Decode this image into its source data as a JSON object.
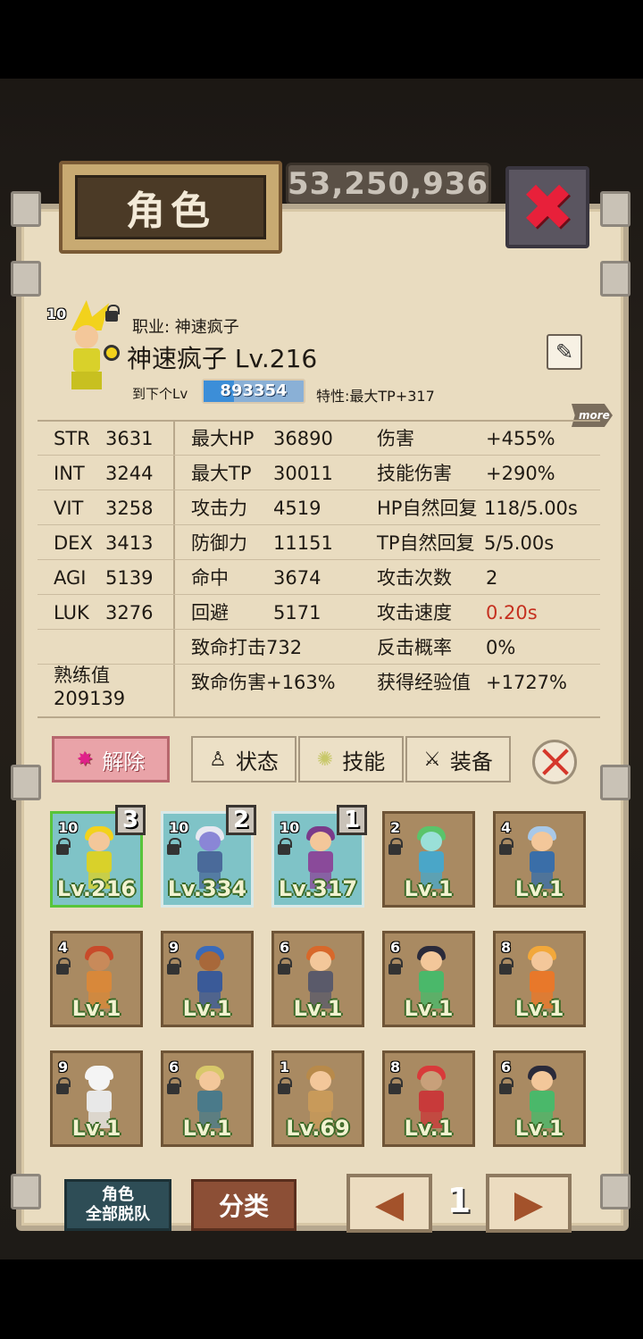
{
  "header": {
    "gold": "53,250,936",
    "title": "角色"
  },
  "character": {
    "job_label": "职业: 神速疯子",
    "name_level": "神速疯子 Lv.216",
    "next_label": "到下个Lv",
    "next_exp": "893354",
    "next_exp_progress": 0.3,
    "trait": "特性:最大TP+317",
    "star": "10",
    "more": "more"
  },
  "stats": {
    "base": [
      {
        "k": "STR",
        "v": "3631"
      },
      {
        "k": "INT",
        "v": "3244"
      },
      {
        "k": "VIT",
        "v": "3258"
      },
      {
        "k": "DEX",
        "v": "3413"
      },
      {
        "k": "AGI",
        "v": "5139"
      },
      {
        "k": "LUK",
        "v": "3276"
      }
    ],
    "proficiency_label": "熟练值",
    "proficiency_value": "209139",
    "mid": [
      {
        "k": "最大HP",
        "v": "36890"
      },
      {
        "k": "最大TP",
        "v": "30011"
      },
      {
        "k": "攻击力",
        "v": "4519"
      },
      {
        "k": "防御力",
        "v": "11151"
      },
      {
        "k": "命中",
        "v": "3674"
      },
      {
        "k": "回避",
        "v": "5171"
      },
      {
        "k": "致命打击",
        "v": "732"
      },
      {
        "k": "致命伤害",
        "v": "+163%"
      }
    ],
    "right": [
      {
        "k": "伤害",
        "v": "+455%"
      },
      {
        "k": "技能伤害",
        "v": "+290%"
      },
      {
        "k": "HP自然回复",
        "v": "118/5.00s"
      },
      {
        "k": "TP自然回复",
        "v": "5/5.00s"
      },
      {
        "k": "攻击次数",
        "v": "2"
      },
      {
        "k": "攻击速度",
        "v": "0.20s"
      },
      {
        "k": "反击概率",
        "v": "0%"
      },
      {
        "k": "获得经验值",
        "v": "+1727%"
      }
    ]
  },
  "tabs": {
    "release": "解除",
    "status": "状态",
    "skill": "技能",
    "equip": "装备"
  },
  "roster": [
    {
      "star": "10",
      "lv": "Lv.216",
      "party": "3",
      "hair": "#f2d21c",
      "skin": "#f3c79a",
      "body": "#d9d12a",
      "sel": true
    },
    {
      "star": "10",
      "lv": "Lv.334",
      "party": "2",
      "hair": "#e8e8f0",
      "skin": "#8a86d6",
      "body": "#4a6a9a"
    },
    {
      "star": "10",
      "lv": "Lv.317",
      "party": "1",
      "hair": "#7a3a8a",
      "skin": "#f3c79a",
      "body": "#8a4a9a"
    },
    {
      "star": "2",
      "lv": "Lv.1",
      "hair": "#5ac46a",
      "skin": "#9ae0d8",
      "body": "#4aa6c8"
    },
    {
      "star": "4",
      "lv": "Lv.1",
      "hair": "#a8c8e8",
      "skin": "#f3c79a",
      "body": "#3a6ea8"
    },
    {
      "star": "4",
      "lv": "Lv.1",
      "hair": "#c84a2a",
      "skin": "#c88a5a",
      "body": "#d8883a"
    },
    {
      "star": "9",
      "lv": "Lv.1",
      "hair": "#3a6ab8",
      "skin": "#a8683a",
      "body": "#3a5a98"
    },
    {
      "star": "6",
      "lv": "Lv.1",
      "hair": "#d8682a",
      "skin": "#f3c79a",
      "body": "#5a5a6a"
    },
    {
      "star": "6",
      "lv": "Lv.1",
      "hair": "#2a2a3a",
      "skin": "#f3c79a",
      "body": "#4ab86a"
    },
    {
      "star": "8",
      "lv": "Lv.1",
      "hair": "#f2a83a",
      "skin": "#f3c79a",
      "body": "#e8782a"
    },
    {
      "star": "9",
      "lv": "Lv.1",
      "hair": "#f4f4f4",
      "skin": "#f4f4f4",
      "body": "#e8e8e8"
    },
    {
      "star": "6",
      "lv": "Lv.1",
      "hair": "#d8c86a",
      "skin": "#f3c79a",
      "body": "#4a7a8a"
    },
    {
      "star": "1",
      "lv": "Lv.69",
      "hair": "#b88a4a",
      "skin": "#f3c79a",
      "body": "#c89a5a"
    },
    {
      "star": "8",
      "lv": "Lv.1",
      "hair": "#d83a3a",
      "skin": "#c8a07a",
      "body": "#c83a3a"
    },
    {
      "star": "6",
      "lv": "Lv.1",
      "hair": "#2a2a3a",
      "skin": "#f3c79a",
      "body": "#4ab86a"
    }
  ],
  "bottom": {
    "dismiss_line1": "角色",
    "dismiss_line2": "全部脱队",
    "sort": "分类",
    "page": "1"
  }
}
